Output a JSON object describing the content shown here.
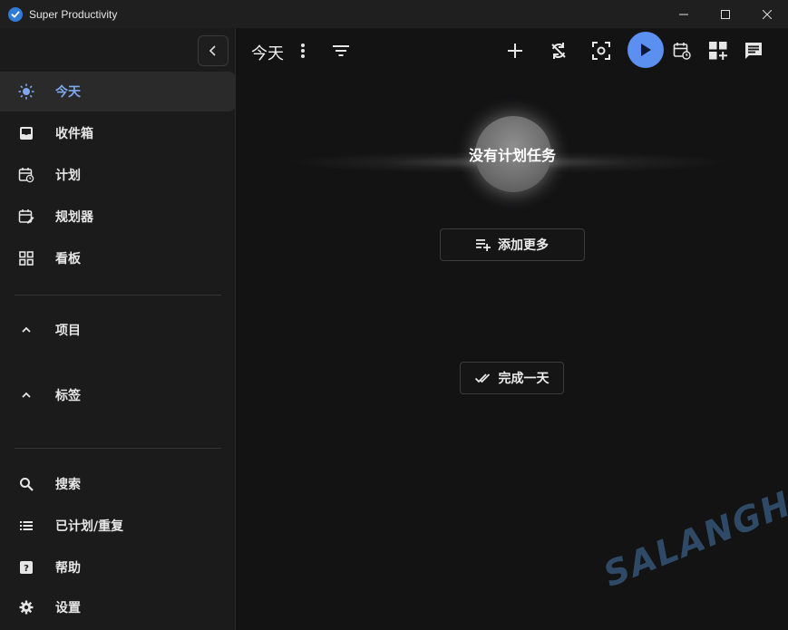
{
  "window": {
    "title": "Super Productivity"
  },
  "sidebar": {
    "items": [
      {
        "label": "今天",
        "icon": "sun-icon",
        "active": true
      },
      {
        "label": "收件箱",
        "icon": "inbox-icon"
      },
      {
        "label": "计划",
        "icon": "calendar-clock-icon"
      },
      {
        "label": "规划器",
        "icon": "calendar-edit-icon"
      },
      {
        "label": "看板",
        "icon": "grid-icon"
      }
    ],
    "sections": [
      {
        "label": "项目",
        "icon": "chevron-up-icon"
      },
      {
        "label": "标签",
        "icon": "chevron-up-icon"
      }
    ],
    "bottom_items": [
      {
        "label": "搜索",
        "icon": "search-icon"
      },
      {
        "label": "已计划/重复",
        "icon": "list-icon"
      },
      {
        "label": "帮助",
        "icon": "help-icon"
      },
      {
        "label": "设置",
        "icon": "gear-icon"
      }
    ]
  },
  "main": {
    "title": "今天",
    "empty_state": "没有计划任务",
    "add_more_label": "添加更多",
    "finish_day_label": "完成一天"
  },
  "watermark": "SALANGHE",
  "colors": {
    "accent": "#5b8ff0",
    "active_text": "#7fa8ee",
    "background": "#131314",
    "sidebar": "#1b1b1c"
  }
}
